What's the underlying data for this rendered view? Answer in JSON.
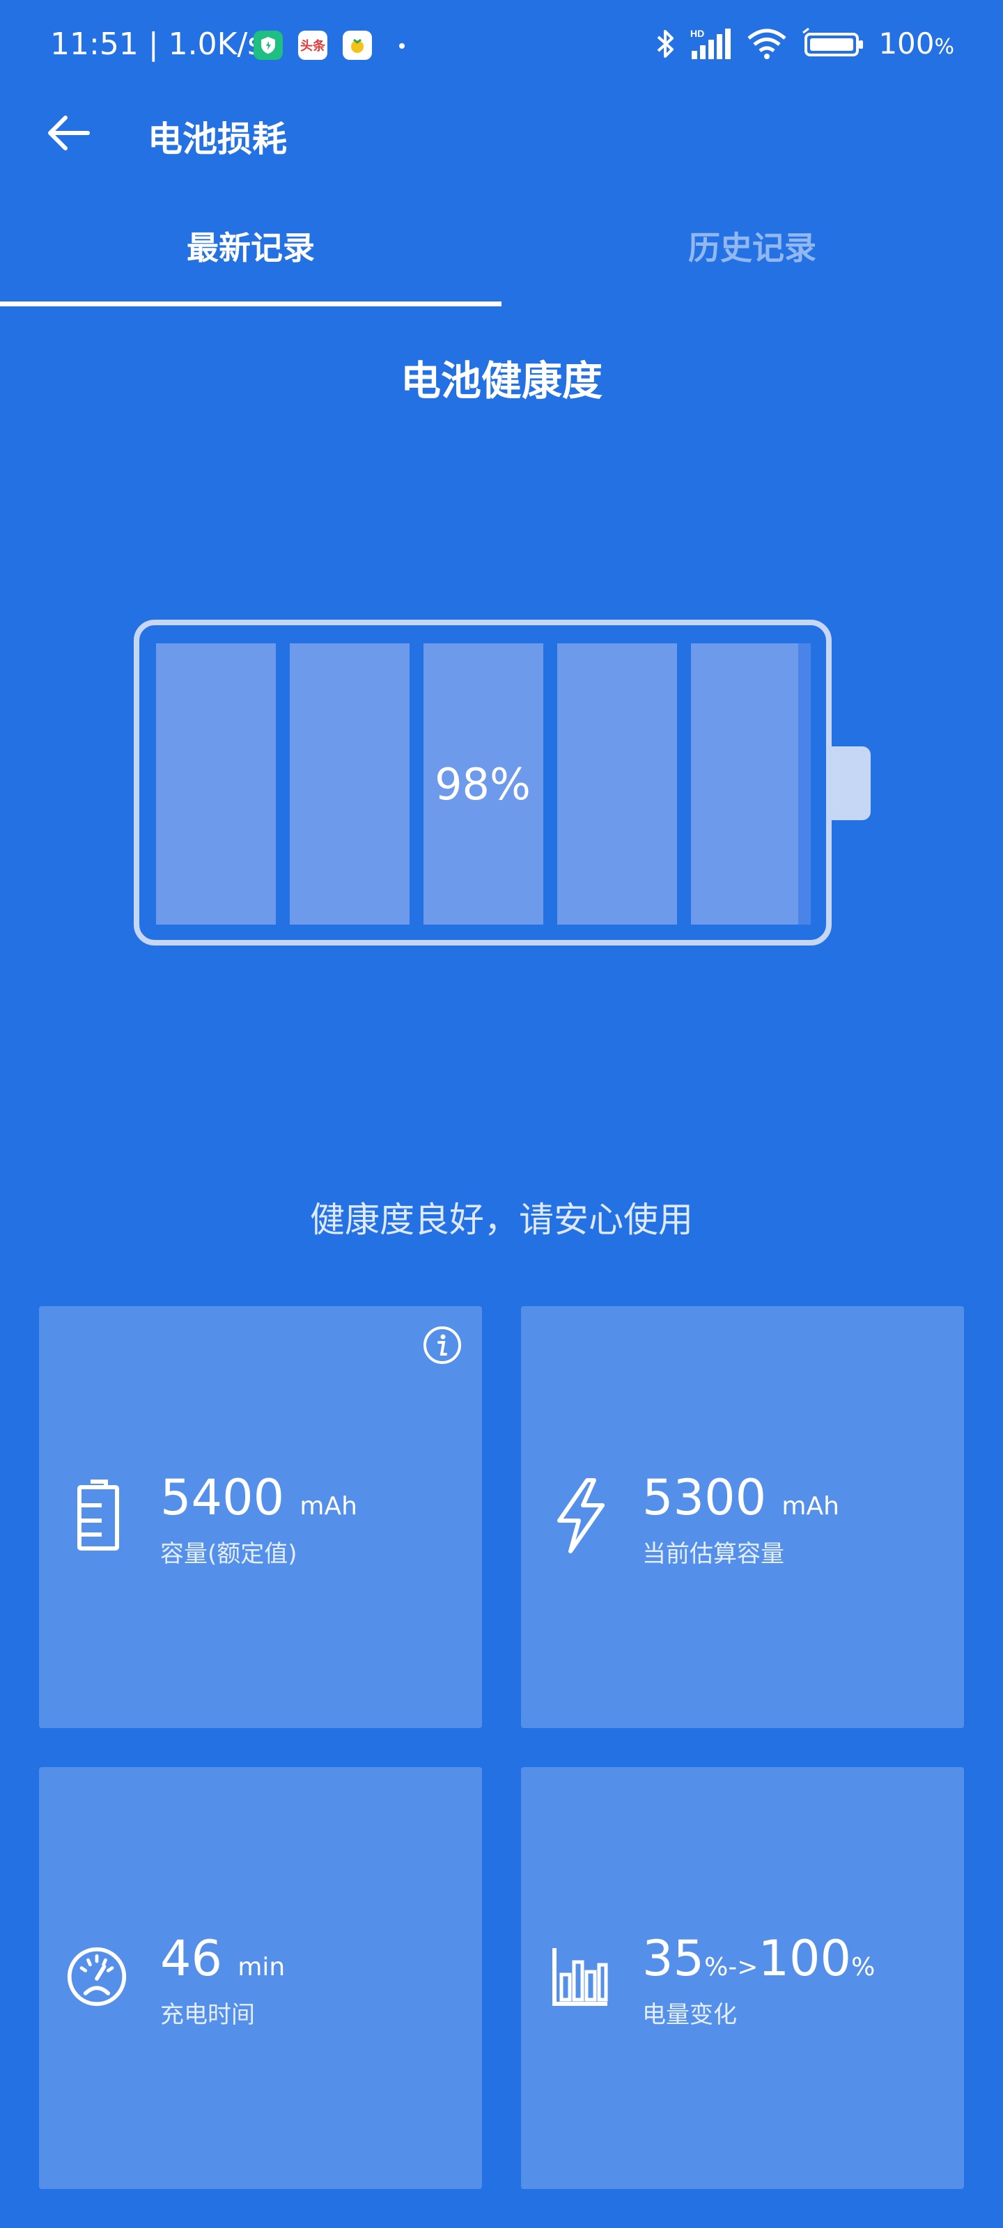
{
  "status_bar": {
    "time": "11:51",
    "separator": "|",
    "net_speed": "1.0K/s",
    "app_icon_2": "头条",
    "battery_level": "100",
    "battery_unit": "%"
  },
  "header": {
    "title": "电池损耗"
  },
  "tabs": [
    {
      "label": "最新记录",
      "active": true
    },
    {
      "label": "历史记录",
      "active": false
    }
  ],
  "health": {
    "section_title": "电池健康度",
    "percent": "98%",
    "percent_value": 98,
    "message": "健康度良好，请安心使用"
  },
  "cards": [
    {
      "icon": "battery-icon",
      "value": "5400",
      "unit": "mAh",
      "label": "容量(额定值)",
      "has_info": true
    },
    {
      "icon": "lightning-icon",
      "value": "5300",
      "unit": "mAh",
      "label": "当前估算容量"
    },
    {
      "icon": "gauge-icon",
      "value": "46",
      "unit": "min",
      "label": "充电时间"
    },
    {
      "icon": "bar-chart-icon",
      "value_from": "35",
      "unit_from": "%->",
      "value_to": "100",
      "unit_to": "%",
      "label": "电量变化"
    }
  ],
  "colors": {
    "background": "#2471e4",
    "cell": "#6d9aeb",
    "outline": "#c6d7f6"
  }
}
